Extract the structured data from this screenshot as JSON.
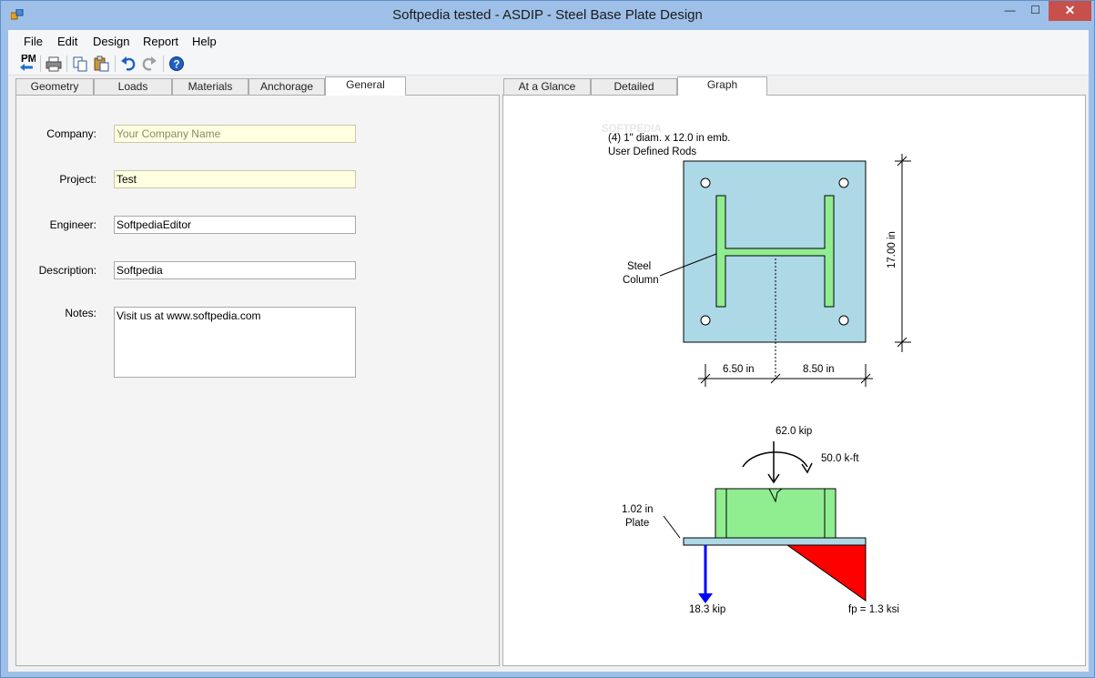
{
  "window": {
    "title": "Softpedia tested - ASDIP - Steel Base Plate Design"
  },
  "menu": [
    "File",
    "Edit",
    "Design",
    "Report",
    "Help"
  ],
  "toolbar": {
    "pm_label": "PM"
  },
  "left_tabs": [
    {
      "label": "Geometry"
    },
    {
      "label": "Loads"
    },
    {
      "label": "Materials"
    },
    {
      "label": "Anchorage"
    },
    {
      "label": "General",
      "active": true
    }
  ],
  "right_tabs": [
    {
      "label": "At a Glance"
    },
    {
      "label": "Detailed"
    },
    {
      "label": "Graph",
      "active": true
    }
  ],
  "general": {
    "company": {
      "label": "Company:",
      "placeholder": "Your Company Name",
      "value": ""
    },
    "project": {
      "label": "Project:",
      "value": "Test"
    },
    "engineer": {
      "label": "Engineer:",
      "value": "SoftpediaEditor"
    },
    "description": {
      "label": "Description:",
      "value": "Softpedia"
    },
    "notes": {
      "label": "Notes:",
      "value": "Visit us at www.softpedia.com"
    }
  },
  "graph": {
    "watermark": "SOFTPEDIA",
    "rods_line1": "(4) 1\" diam. x 12.0 in emb.",
    "rods_line2": "User Defined Rods",
    "column_label_line1": "Steel",
    "column_label_line2": "Column",
    "height_dim": "17.00 in",
    "left_dim": "6.50 in",
    "right_dim": "8.50 in",
    "axial_load": "62.0 kip",
    "moment": "50.0 k-ft",
    "plate_thickness_line1": "1.02 in",
    "plate_thickness_line2": "Plate",
    "anchor_tension": "18.3 kip",
    "bearing_pressure": "fp = 1.3 ksi",
    "colors": {
      "plate": "#add8e6",
      "column": "#90ee90",
      "pressure": "#ff0000",
      "tension": "#0000ff"
    }
  }
}
